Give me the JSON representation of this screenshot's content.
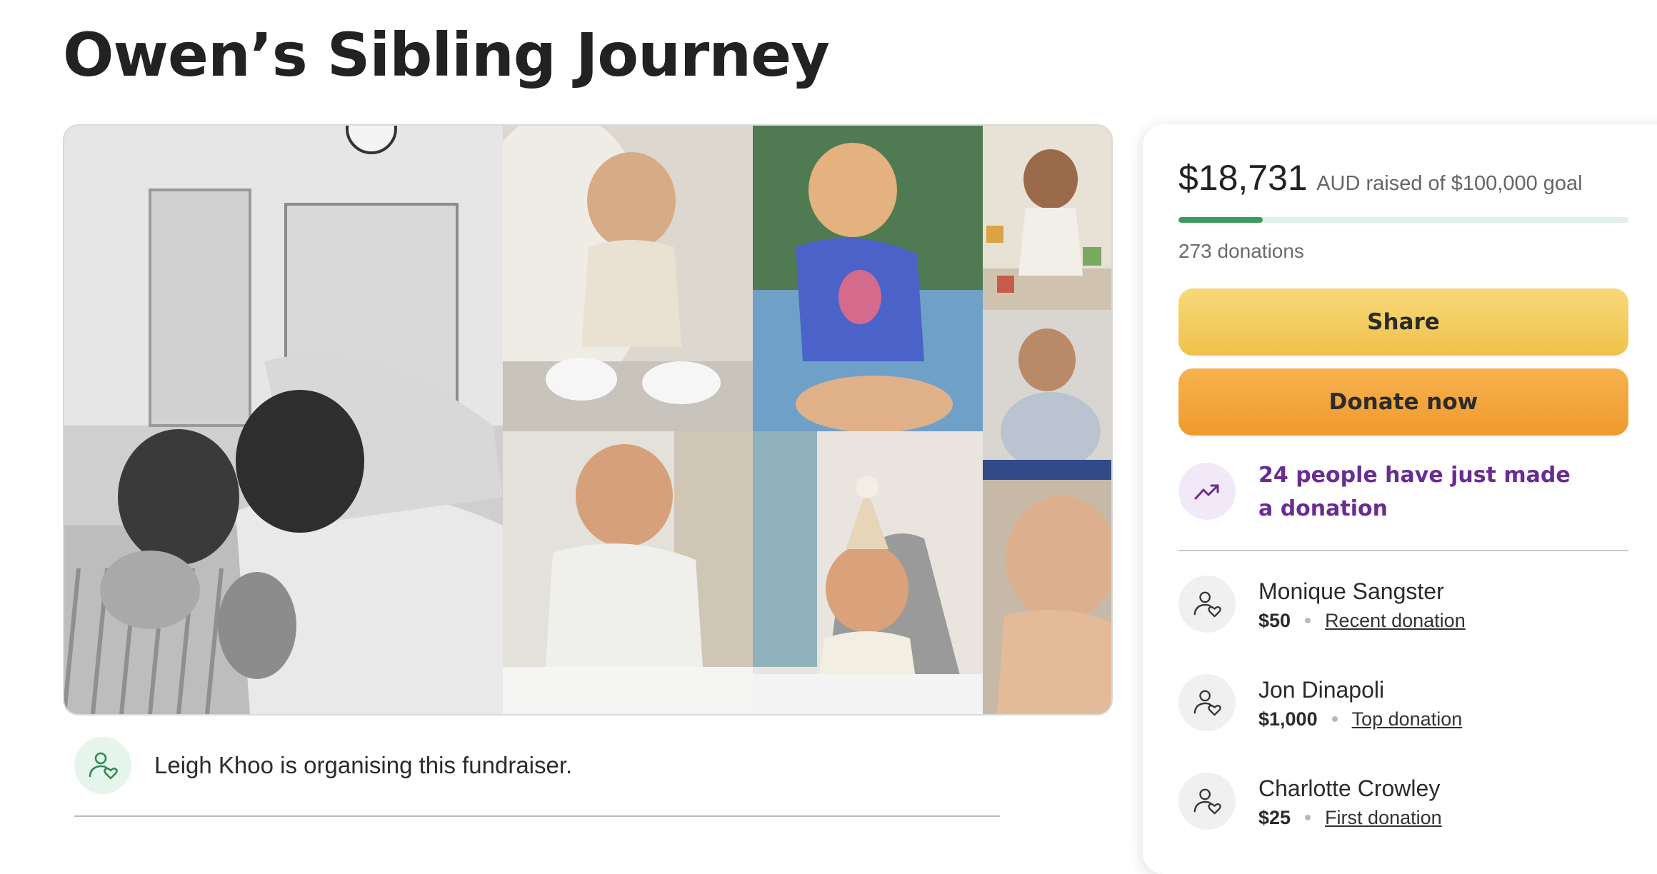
{
  "page": {
    "title": "Owen’s Sibling Journey"
  },
  "organiser": {
    "text": "Leigh Khoo is organising this fundraiser.",
    "icon": "person-heart-icon"
  },
  "gallery": {
    "photos": [
      {
        "name": "parents-kissing-baby-hospital-photo"
      },
      {
        "name": "baby-sitting-cream-outfit-photo"
      },
      {
        "name": "baby-strawberry-swimsuit-photo"
      },
      {
        "name": "baby-with-blocks-photo"
      },
      {
        "name": "baby-with-plush-elephant-photo"
      },
      {
        "name": "baby-smiling-white-top-photo"
      },
      {
        "name": "baby-first-birthday-hat-photo"
      },
      {
        "name": "baby-laughing-closeup-photo"
      }
    ]
  },
  "fundraiser": {
    "amount_raised": "$18,731",
    "goal_text": "AUD raised of $100,000 goal",
    "progress_fraction": 0.187,
    "donations_count": "273 donations",
    "share_label": "Share",
    "donate_label": "Donate now",
    "trend_text": "24 people have just made a donation",
    "trend_icon": "trending-up-icon",
    "colors": {
      "progress": "#3c9a5f",
      "trend": "#6a2c91",
      "share": "#f0c14b",
      "donate": "#ef9a2c"
    }
  },
  "donors": [
    {
      "name": "Monique Sangster",
      "amount": "$50",
      "tag": "Recent donation"
    },
    {
      "name": "Jon Dinapoli",
      "amount": "$1,000",
      "tag": "Top donation"
    },
    {
      "name": "Charlotte Crowley",
      "amount": "$25",
      "tag": "First donation"
    }
  ]
}
